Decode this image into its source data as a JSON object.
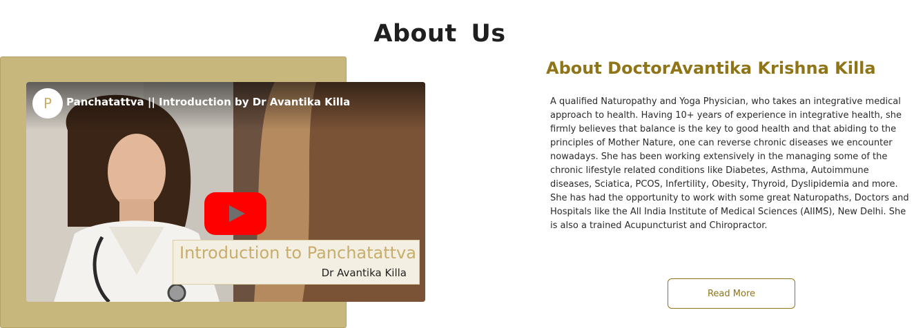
{
  "section": {
    "title": "About  Us"
  },
  "video": {
    "channel_initial": "P",
    "title": "Panchatattva || Introduction by Dr Avantika Killa",
    "caption_title": "Introduction to Panchatattva",
    "caption_subtitle": "Dr Avantika Killa",
    "play_icon": "youtube-play-icon",
    "colors": {
      "play": "#ff0000",
      "caption_text": "#c8ad6b"
    }
  },
  "about": {
    "heading": "About DoctorAvantika Krishna Killa",
    "body": "A qualified Naturopathy and Yoga Physician, who takes an integrative medical approach to health. Having 10+ years of experience in integrative health, she firmly believes that balance is the key to good health and that abiding to the principles of Mother Nature, one can reverse chronic diseases we encounter nowadays. She has been working extensively in the managing some of the chronic lifestyle related conditions like Diabetes, Asthma, Autoimmune diseases, Sciatica, PCOS, Infertility, Obesity, Thyroid, Dyslipidemia and more. She has had the opportunity to work with some great Naturopaths, Doctors and Hospitals like the All India Institute of Medical Sciences (AIIMS), New Delhi. She is also a trained Acupuncturist and Chiropractor.",
    "read_more_label": "Read More"
  },
  "colors": {
    "accent": "#8f7418",
    "panel": "#c8b77c"
  }
}
